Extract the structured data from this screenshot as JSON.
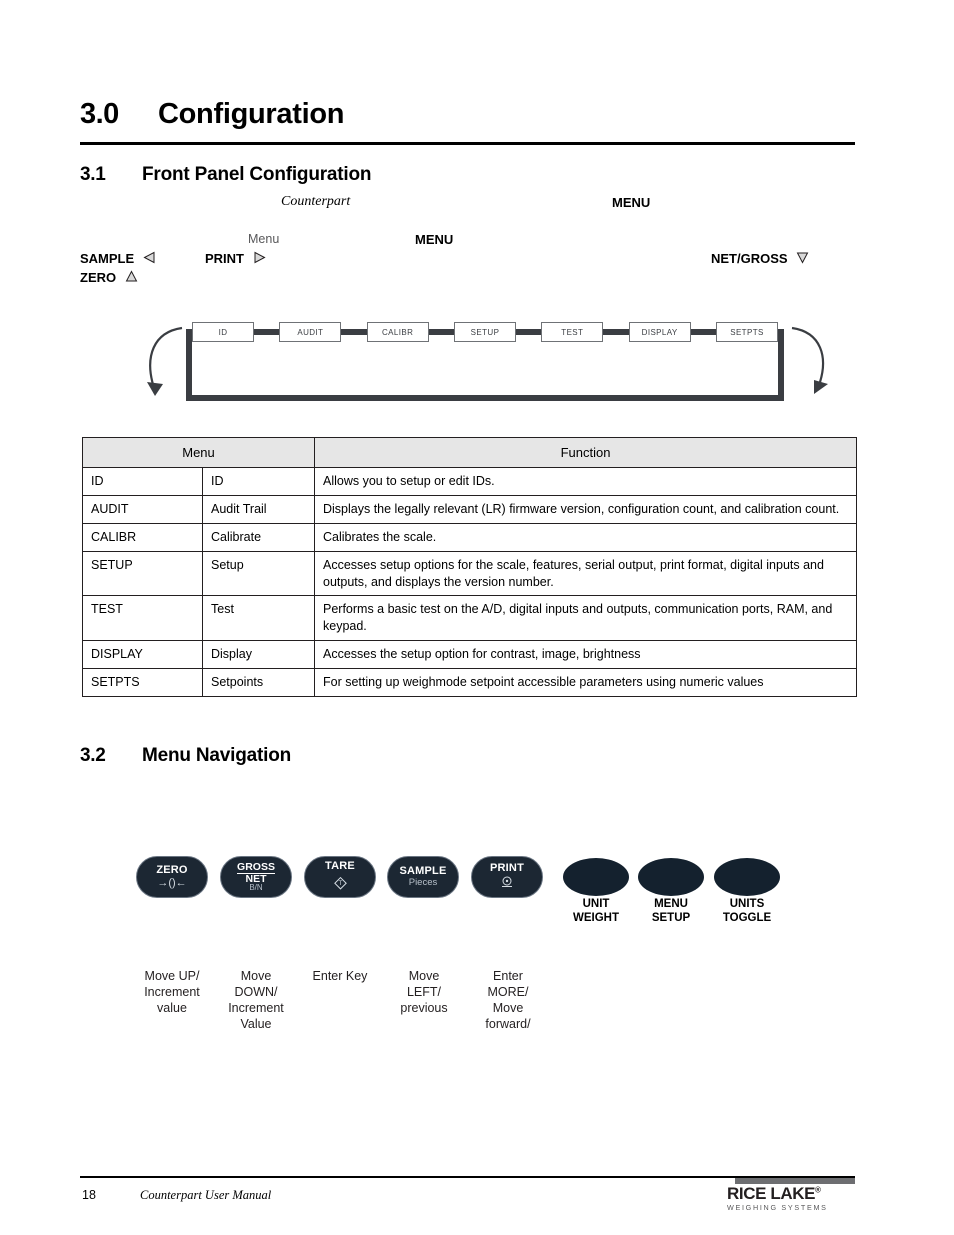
{
  "document": {
    "sections": {
      "s30": {
        "number": "3.0",
        "title": "Configuration"
      },
      "s31": {
        "number": "3.1",
        "title": "Front Panel Configuration"
      },
      "s32": {
        "number": "3.2",
        "title": "Menu Navigation"
      }
    },
    "body_fragments": {
      "counterpart": "Counterpart",
      "menu_caps_1": "MENU",
      "menu_word": "Menu",
      "menu_caps_2": "MENU",
      "sample": "SAMPLE",
      "print": "PRINT",
      "zero": "ZERO",
      "net_gross": "NET/GROSS"
    },
    "glyphs": {
      "left_triangle": "◁",
      "right_triangle": "▷",
      "up_triangle": "△",
      "down_triangle": "▽"
    }
  },
  "flow_diagram": {
    "name": "main-menu-loop",
    "items": [
      "ID",
      "AUDIT",
      "CALIBR",
      "SETUP",
      "TEST",
      "DISPLAY",
      "SETPTS"
    ]
  },
  "menu_table": {
    "headers": [
      "Menu",
      "Function"
    ],
    "rows": [
      {
        "code": "ID",
        "name": "ID",
        "function": "Allows you to setup or edit IDs."
      },
      {
        "code": "AUDIT",
        "name": "Audit Trail",
        "function": "Displays the legally relevant (LR) firmware version, configuration count, and calibration count."
      },
      {
        "code": "CALIBR",
        "name": "Calibrate",
        "function": "Calibrates the scale."
      },
      {
        "code": "SETUP",
        "name": "Setup",
        "function": "Accesses setup options for the scale, features, serial output, print format, digital inputs and outputs, and displays the version number."
      },
      {
        "code": "TEST",
        "name": "Test",
        "function": "Performs a basic test on the A/D, digital inputs and outputs, communication ports, RAM, and keypad."
      },
      {
        "code": "DISPLAY",
        "name": "Display",
        "function": "Accesses the setup option for contrast, image, brightness"
      },
      {
        "code": "SETPTS",
        "name": "Setpoints",
        "function": "For setting up weighmode setpoint accessible parameters using numeric values"
      }
    ]
  },
  "keypad": {
    "keys": [
      {
        "label": "ZERO",
        "sub": "",
        "glyph": "→()←",
        "caption": "Move UP/\nIncrement\nvalue"
      },
      {
        "label": "GROSS",
        "label2": "NET",
        "sub": "B/N",
        "glyph": "",
        "caption": "Move\nDOWN/\nIncrement\nValue"
      },
      {
        "label": "TARE",
        "sub": "",
        "glyph": "↬",
        "caption": "Enter Key"
      },
      {
        "label": "SAMPLE",
        "sub": "Pieces",
        "glyph": "",
        "caption": "Move\nLEFT/\nprevious"
      },
      {
        "label": "PRINT",
        "sub": "",
        "glyph": "⊙",
        "caption": "Enter\nMORE/\nMove\nforward/"
      }
    ],
    "function_keys": [
      {
        "line1": "UNIT",
        "line2": "WEIGHT"
      },
      {
        "line1": "MENU",
        "line2": "SETUP"
      },
      {
        "line1": "UNITS",
        "line2": "TOGGLE"
      }
    ]
  },
  "footer": {
    "page_number": "18",
    "manual_title": "Counterpart User Manual",
    "logo_main": "RICE LAKE",
    "logo_reg": "®",
    "logo_sub": "WEIGHING SYSTEMS"
  },
  "colors": {
    "rule": "#000000",
    "table_header_bg": "#e6e6e6",
    "key_fill": "#1c2733",
    "flow_stroke": "#3a3d42"
  }
}
